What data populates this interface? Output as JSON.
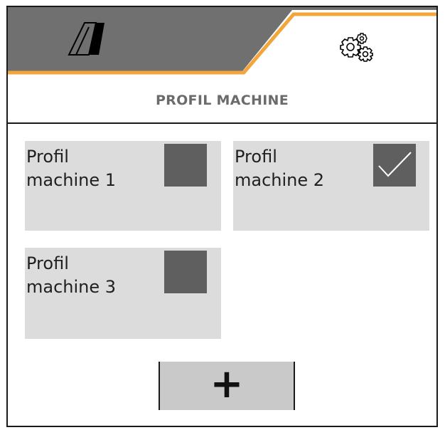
{
  "header": {
    "tabs": [
      {
        "name": "machine",
        "icon": "machine-icon",
        "active": false
      },
      {
        "name": "settings",
        "icon": "gears-icon",
        "active": true
      }
    ],
    "colors": {
      "dark": "#707070",
      "accent": "#f2a53a"
    }
  },
  "page": {
    "title": "PROFIL MACHINE"
  },
  "profiles": [
    {
      "label": "Profil\nmachine 1",
      "selected": false
    },
    {
      "label": "Profil\nmachine 2",
      "selected": true
    },
    {
      "label": "Profil\nmachine 3",
      "selected": false
    }
  ],
  "add_button": {
    "label": "+"
  }
}
